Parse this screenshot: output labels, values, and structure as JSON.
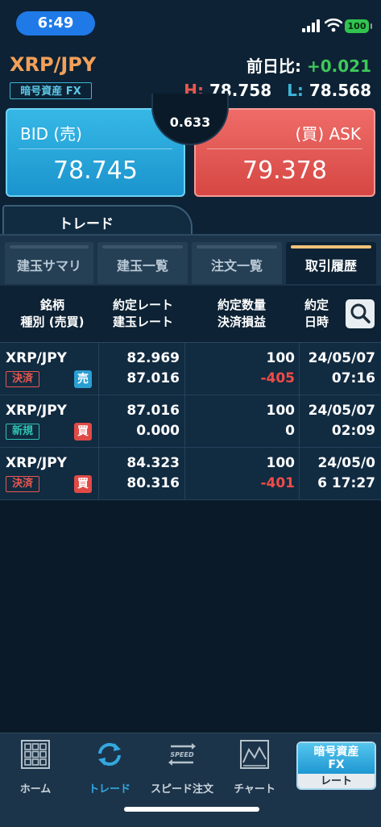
{
  "status_bar": {
    "time": "6:49",
    "battery": "100"
  },
  "header": {
    "symbol": "XRP/JPY",
    "asset_badge": "暗号資産 FX",
    "prev_label": "前日比:",
    "prev_value": "+0.021",
    "high_label": "H:",
    "high_value": "78.758",
    "low_label": "L:",
    "low_value": "78.568"
  },
  "quote": {
    "bid_label": "BID (売)",
    "bid_price": "78.745",
    "ask_label": "(買) ASK",
    "ask_price": "79.378",
    "spread": "0.633"
  },
  "trade_tab": "トレード",
  "subtabs": [
    {
      "label": "建玉サマリ"
    },
    {
      "label": "建玉一覧"
    },
    {
      "label": "注文一覧"
    },
    {
      "label": "取引履歴"
    }
  ],
  "table": {
    "headers": {
      "c1_l1": "銘柄",
      "c1_l2": "種別 (売買)",
      "c2_l1": "約定レート",
      "c2_l2": "建玉レート",
      "c3_l1": "約定数量",
      "c3_l2": "決済損益",
      "c4_l1": "約定",
      "c4_l2": "日時"
    },
    "rows": [
      {
        "symbol": "XRP/JPY",
        "type": "決済",
        "side": "売",
        "rate": "82.969",
        "open_rate": "87.016",
        "qty": "100",
        "pnl": "-405",
        "date": "24/05/07",
        "time": "07:16"
      },
      {
        "symbol": "XRP/JPY",
        "type": "新規",
        "side": "買",
        "rate": "87.016",
        "open_rate": "0.000",
        "qty": "100",
        "pnl": "0",
        "date": "24/05/07",
        "time": "02:09"
      },
      {
        "symbol": "XRP/JPY",
        "type": "決済",
        "side": "買",
        "rate": "84.323",
        "open_rate": "80.316",
        "qty": "100",
        "pnl": "-401",
        "date": "24/05/0",
        "time": "6 17:27"
      }
    ]
  },
  "bottom_nav": [
    {
      "label": "ホーム",
      "icon": "grid-icon"
    },
    {
      "label": "トレード",
      "icon": "refresh-arrows-icon"
    },
    {
      "label": "スピード注文",
      "icon": "speed-arrows-icon"
    },
    {
      "label": "チャート",
      "icon": "chart-icon"
    }
  ],
  "fx_button": {
    "top": "暗号資産\nFX",
    "bottom": "レート"
  },
  "speed_icon_text": "SPEED",
  "colors": {
    "bid": "#1b94cd",
    "ask": "#d64743",
    "positive": "#3ec85a",
    "negative": "#ef4c48",
    "symbol": "#f2a05a"
  }
}
